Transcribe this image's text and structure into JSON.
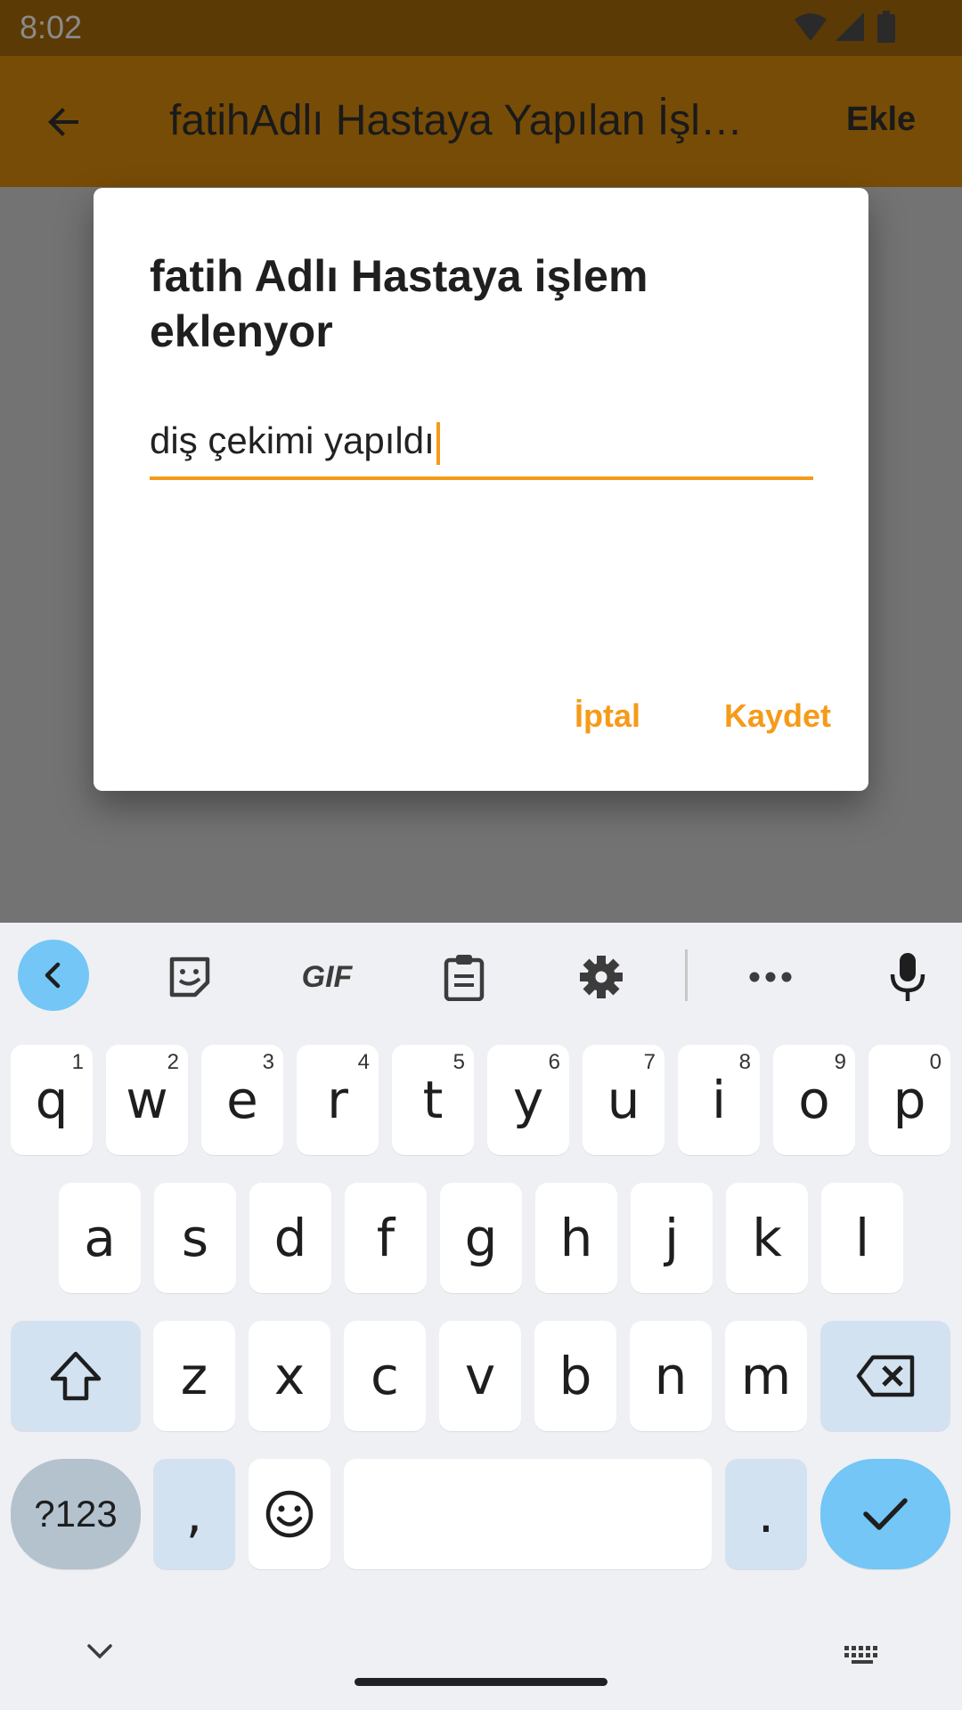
{
  "status_bar": {
    "time": "8:02"
  },
  "app_bar": {
    "title": "fatihAdlı Hastaya Yapılan İşlemler",
    "action_label": "Ekle"
  },
  "dialog": {
    "title": "fatih Adlı Hastaya işlem eklenyor",
    "input_value": "diş çekimi yapıldı",
    "cancel_label": "İptal",
    "save_label": "Kaydet"
  },
  "keyboard": {
    "toolbar": [
      "back-chevron-icon",
      "sticker-icon",
      "gif-icon",
      "clipboard-icon",
      "gear-icon",
      "more-icon",
      "microphone-icon"
    ],
    "gif_label": "GIF",
    "row1": [
      {
        "k": "q",
        "h": "1"
      },
      {
        "k": "w",
        "h": "2"
      },
      {
        "k": "e",
        "h": "3"
      },
      {
        "k": "r",
        "h": "4"
      },
      {
        "k": "t",
        "h": "5"
      },
      {
        "k": "y",
        "h": "6"
      },
      {
        "k": "u",
        "h": "7"
      },
      {
        "k": "i",
        "h": "8"
      },
      {
        "k": "o",
        "h": "9"
      },
      {
        "k": "p",
        "h": "0"
      }
    ],
    "row2": [
      "a",
      "s",
      "d",
      "f",
      "g",
      "h",
      "j",
      "k",
      "l"
    ],
    "row3": [
      "z",
      "x",
      "c",
      "v",
      "b",
      "n",
      "m"
    ],
    "symbols_label": "?123",
    "comma_label": ",",
    "period_label": "."
  },
  "colors": {
    "status_bar": "#5b3a05",
    "app_bar": "#774c06",
    "accent": "#f59b1a",
    "keyboard_bg": "#eff0f4",
    "key_blue": "#73c6f5"
  }
}
